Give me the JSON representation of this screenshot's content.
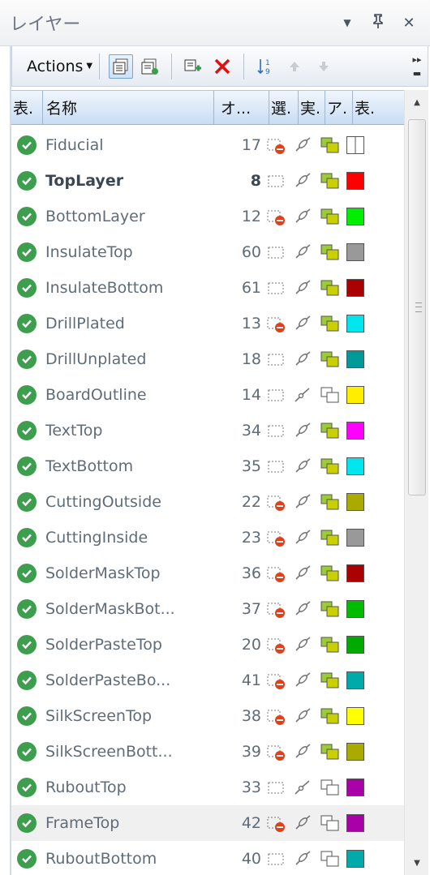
{
  "panel": {
    "title": "レイヤー",
    "dropdown_icon": "▼",
    "pin_icon": "ᵖ",
    "close_icon": "✕"
  },
  "toolbar": {
    "actions_label": "Actions",
    "actions_caret": "▼",
    "overflow_label": "▸▸"
  },
  "columns": [
    "表.",
    "名称",
    "オ...",
    "選.",
    "実.",
    "ア.",
    "表."
  ],
  "layers": [
    {
      "name": "Fiducial",
      "number": "17",
      "select": "outline",
      "exec": "link",
      "active": "green",
      "color": "#ffffff",
      "swatch_type": "grid"
    },
    {
      "name": "TopLayer",
      "number": "8",
      "select": "plain",
      "exec": "link",
      "active": "green",
      "color": "#ff0000",
      "bold": true
    },
    {
      "name": "BottomLayer",
      "number": "12",
      "select": "outline",
      "exec": "link",
      "active": "green",
      "color": "#00ee00"
    },
    {
      "name": "InsulateTop",
      "number": "60",
      "select": "plain",
      "exec": "link",
      "active": "green",
      "color": "#999999"
    },
    {
      "name": "InsulateBottom",
      "number": "61",
      "select": "plain",
      "exec": "link",
      "active": "green",
      "color": "#aa0000"
    },
    {
      "name": "DrillPlated",
      "number": "13",
      "select": "outline",
      "exec": "link",
      "active": "green",
      "color": "#00e5ee"
    },
    {
      "name": "DrillUnplated",
      "number": "18",
      "select": "plain",
      "exec": "link",
      "active": "green",
      "color": "#009999"
    },
    {
      "name": "BoardOutline",
      "number": "14",
      "select": "plain",
      "exec": "link-off",
      "active": "outline",
      "color": "#ffee00"
    },
    {
      "name": "TextTop",
      "number": "34",
      "select": "plain",
      "exec": "link",
      "active": "green",
      "color": "#ff00ff"
    },
    {
      "name": "TextBottom",
      "number": "35",
      "select": "plain",
      "exec": "link",
      "active": "green",
      "color": "#00e5ee"
    },
    {
      "name": "CuttingOutside",
      "number": "22",
      "select": "outline",
      "exec": "link",
      "active": "green",
      "color": "#aaaa00"
    },
    {
      "name": "CuttingInside",
      "number": "23",
      "select": "outline",
      "exec": "link",
      "active": "green",
      "color": "#999999"
    },
    {
      "name": "SolderMaskTop",
      "number": "36",
      "select": "outline",
      "exec": "link",
      "active": "green",
      "color": "#aa0000"
    },
    {
      "name": "SolderMaskBot...",
      "number": "37",
      "select": "outline",
      "exec": "link",
      "active": "green",
      "color": "#00bb00"
    },
    {
      "name": "SolderPasteTop",
      "number": "20",
      "select": "outline",
      "exec": "link",
      "active": "green",
      "color": "#00aa00"
    },
    {
      "name": "SolderPasteBo...",
      "number": "41",
      "select": "outline",
      "exec": "link",
      "active": "green",
      "color": "#00aaaa"
    },
    {
      "name": "SilkScreenTop",
      "number": "38",
      "select": "outline",
      "exec": "link",
      "active": "green",
      "color": "#ffff00"
    },
    {
      "name": "SilkScreenBott...",
      "number": "39",
      "select": "outline",
      "exec": "link",
      "active": "green",
      "color": "#aaaa00"
    },
    {
      "name": "RuboutTop",
      "number": "33",
      "select": "plain",
      "exec": "link-off",
      "active": "outline",
      "color": "#aa00aa"
    },
    {
      "name": "FrameTop",
      "number": "42",
      "select": "outline",
      "exec": "link",
      "active": "outline",
      "color": "#aa00aa",
      "selected": true
    },
    {
      "name": "RuboutBottom",
      "number": "40",
      "select": "plain",
      "exec": "link",
      "active": "outline",
      "color": "#00aaaa"
    }
  ],
  "scrollbar": {
    "up_arrow": "▲",
    "down_arrow": "▼"
  }
}
